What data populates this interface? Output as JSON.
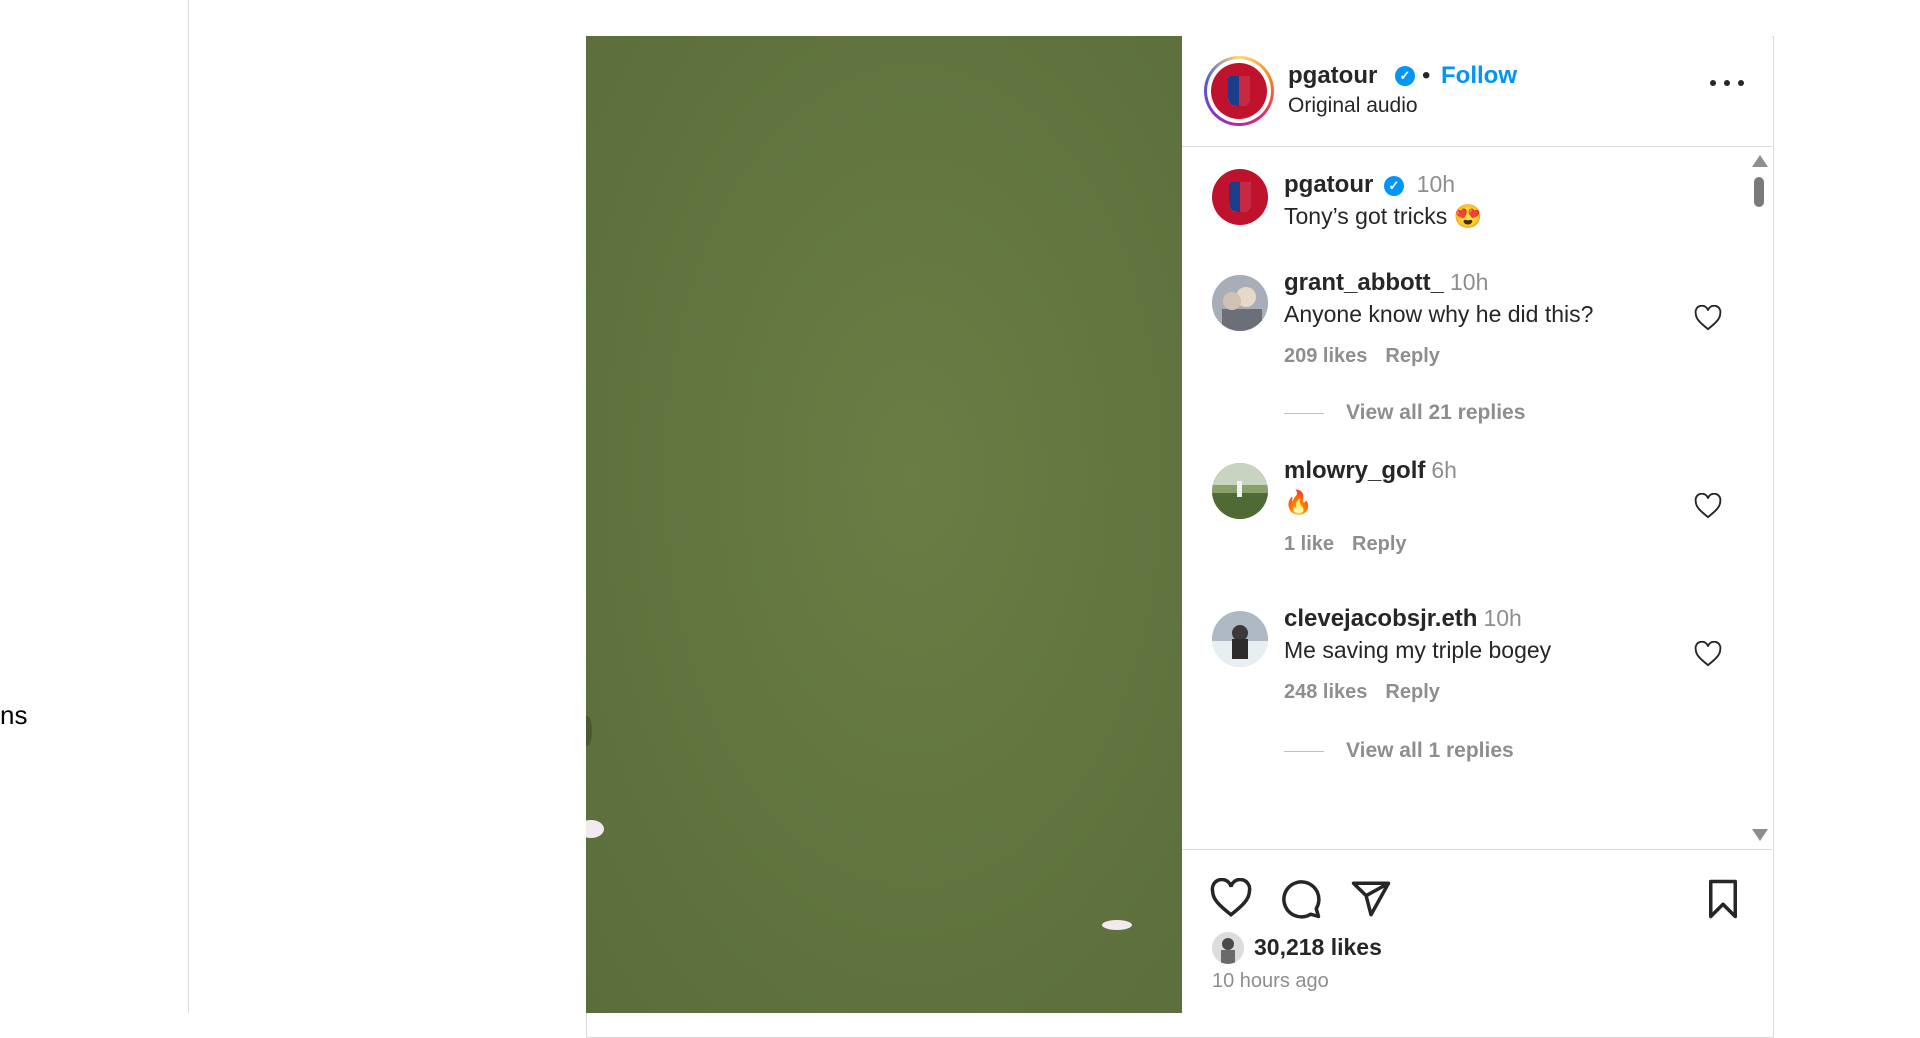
{
  "sidebar": {
    "nav_fragment": "ns"
  },
  "post": {
    "author": "pgatour",
    "follow_label": "Follow",
    "separator": "•",
    "audio": "Original audio",
    "verified_mark": "✓"
  },
  "caption": {
    "username": "pgatour",
    "time": "10h",
    "text": "Tony’s got tricks",
    "emoji": "😍"
  },
  "comments": [
    {
      "username": "grant_abbott_",
      "time": "10h",
      "text": "Anyone know why he did this?",
      "likes": "209 likes",
      "reply": "Reply",
      "view_replies": "View all 21 replies"
    },
    {
      "username": "mlowry_golf",
      "time": "6h",
      "text": "🔥",
      "likes": "1 like",
      "reply": "Reply"
    },
    {
      "username": "clevejacobsjr.eth",
      "time": "10h",
      "text": "Me saving my triple bogey",
      "likes": "248 likes",
      "reply": "Reply",
      "view_replies": "View all 1 replies"
    }
  ],
  "footer": {
    "likes": "30,218 likes",
    "time_ago": "10 hours ago"
  },
  "icons": [
    "heart-icon",
    "comment-icon",
    "share-icon",
    "bookmark-icon",
    "more-icon",
    "verified-icon"
  ],
  "colors": {
    "accent": "#0095f6",
    "brand_red": "#c0122c",
    "green": "#627540",
    "muted": "#8e8e8e"
  }
}
